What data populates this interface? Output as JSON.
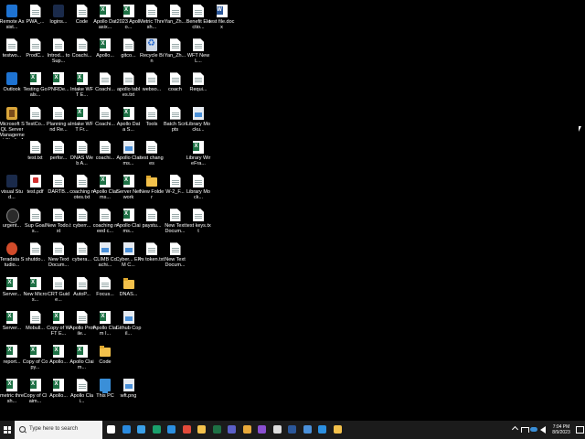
{
  "desktop": {
    "icons": [
      {
        "name": "remote-assistance-icon",
        "label": "Remote Assist...",
        "kind": "app-blue"
      },
      {
        "name": "pwa-icon",
        "label": "PWA_...",
        "kind": "doc"
      },
      {
        "name": "logins-icon",
        "label": "logins...",
        "kind": "app-navy"
      },
      {
        "name": "code-icon",
        "label": "Code",
        "kind": "doc"
      },
      {
        "name": "apollo-datasix-icon",
        "label": "Apollo Datasix...",
        "kind": "excel"
      },
      {
        "name": "apollo-2023-icon",
        "label": "2023 Apollo...",
        "kind": "excel"
      },
      {
        "name": "metric-thresh-icon",
        "label": "Metric Thresh...",
        "kind": "doc"
      },
      {
        "name": "yan-zh-icon",
        "label": "Yan_Zh...",
        "kind": "doc"
      },
      {
        "name": "benefit-electio-icon",
        "label": "Benefit Electio...",
        "kind": "doc"
      },
      {
        "name": "test-file-icon",
        "label": "test file.docx",
        "kind": "word"
      },
      {
        "name": "testwo-icon",
        "label": "testwo...",
        "kind": "doc"
      },
      {
        "name": "prodc-icon",
        "label": "ProdC...",
        "kind": "doc"
      },
      {
        "name": "introd-icon",
        "label": "Introd... to Sup...",
        "kind": "doc"
      },
      {
        "name": "coachi-1-icon",
        "label": "Coachi...",
        "kind": "doc"
      },
      {
        "name": "apollo-1-icon",
        "label": "Apollo...",
        "kind": "excel"
      },
      {
        "name": "gitco-icon",
        "label": "gitco...",
        "kind": "doc"
      },
      {
        "name": "recycle-bin-icon",
        "label": "Recycle Bin",
        "kind": "recycle"
      },
      {
        "name": "yan-zh-2-icon",
        "label": "Yan_Zh...",
        "kind": "doc"
      },
      {
        "name": "wft-new-icon",
        "label": "WFT New L...",
        "kind": "doc"
      },
      {
        "name": "outlook-icon",
        "label": "Outlook",
        "kind": "app-blue"
      },
      {
        "name": "testing-goals-icon",
        "label": "Testing Goals...",
        "kind": "excel"
      },
      {
        "name": "pnrde-icon",
        "label": "PNRDe...",
        "kind": "excel"
      },
      {
        "name": "intake-wft-icon",
        "label": "Intake WFT E...",
        "kind": "excel"
      },
      {
        "name": "coachi-2-icon",
        "label": "Coachi...",
        "kind": "doc"
      },
      {
        "name": "apollo-tables-icon",
        "label": "apollo tables.txt",
        "kind": "doc"
      },
      {
        "name": "webso-icon",
        "label": "webso...",
        "kind": "doc"
      },
      {
        "name": "coach-icon",
        "label": "coach",
        "kind": "doc"
      },
      {
        "name": "requi-icon",
        "label": "Requi...",
        "kind": "doc"
      },
      {
        "name": "ssms-icon",
        "label": "Microsoft SQL Server Management Studio 18",
        "kind": "ssms"
      },
      {
        "name": "testco-icon",
        "label": "TestCo...",
        "kind": "doc"
      },
      {
        "name": "planning-icon",
        "label": "Planning and Re...",
        "kind": "doc"
      },
      {
        "name": "intake-wft-fr-icon",
        "label": "Intake WFT Fr...",
        "kind": "excel"
      },
      {
        "name": "coachi-3-icon",
        "label": "Coachi...",
        "kind": "doc"
      },
      {
        "name": "apollo-data-icon",
        "label": "Apollo Data S...",
        "kind": "excel"
      },
      {
        "name": "tools-icon",
        "label": "Tools",
        "kind": "doc"
      },
      {
        "name": "batch-scripts-icon",
        "label": "Batch Scripts",
        "kind": "doc"
      },
      {
        "name": "library-mocku-icon",
        "label": "Library Mocku...",
        "kind": "image"
      },
      {
        "name": "test-txt-icon",
        "label": "test.txt",
        "kind": "doc"
      },
      {
        "name": "perfor-icon",
        "label": "perfor...",
        "kind": "doc"
      },
      {
        "name": "dnas-web-icon",
        "label": "DNAS Web A...",
        "kind": "doc"
      },
      {
        "name": "coachi-4-icon",
        "label": "coachi...",
        "kind": "doc"
      },
      {
        "name": "apollo-claims-icon",
        "label": "Apollo Claims...",
        "kind": "image"
      },
      {
        "name": "test-changes-icon",
        "label": "test changes",
        "kind": "doc"
      },
      {
        "name": "library-wirefra-icon",
        "label": "Library WireFra...",
        "kind": "excel"
      },
      {
        "name": "visual-studio-icon",
        "label": "visual Stud...",
        "kind": "app-navy"
      },
      {
        "name": "test-pdf-icon",
        "label": "test.pdf",
        "kind": "pdf"
      },
      {
        "name": "dartb-icon",
        "label": "DARTB...",
        "kind": "doc"
      },
      {
        "name": "coaching-notes-icon",
        "label": "coaching notes.txt",
        "kind": "doc"
      },
      {
        "name": "apollo-claims-2-icon",
        "label": "Apollo Claims...",
        "kind": "excel"
      },
      {
        "name": "server-network-icon",
        "label": "Server Network",
        "kind": "excel"
      },
      {
        "name": "new-folder-icon",
        "label": "New Folder",
        "kind": "folder"
      },
      {
        "name": "w2-f-icon",
        "label": "W-2_F...",
        "kind": "doc"
      },
      {
        "name": "library-mock-icon",
        "label": "Library Mock...",
        "kind": "doc"
      },
      {
        "name": "urgent-icon",
        "label": "urgent...",
        "kind": "setting"
      },
      {
        "name": "sup-goals-icon",
        "label": "Sup Goals...",
        "kind": "doc"
      },
      {
        "name": "new-todo-icon",
        "label": "New Todo.txt",
        "kind": "doc"
      },
      {
        "name": "cyberr-icon",
        "label": "cyberr...",
        "kind": "doc"
      },
      {
        "name": "coaching-need-icon",
        "label": "coaching need c...",
        "kind": "doc"
      },
      {
        "name": "apollo-claims-3-icon",
        "label": "Apollo Claims...",
        "kind": "excel"
      },
      {
        "name": "paystu-icon",
        "label": "paystu...",
        "kind": "doc"
      },
      {
        "name": "new-text-docum-icon",
        "label": "New Text Docum...",
        "kind": "doc"
      },
      {
        "name": "test-keys-icon",
        "label": "test keys.txt",
        "kind": "doc"
      },
      {
        "name": "teradata-studio-icon",
        "label": "Teradata Studio...",
        "kind": "app-red"
      },
      {
        "name": "shutdo-icon",
        "label": "shutdo...",
        "kind": "doc"
      },
      {
        "name": "new-text-docum-2-icon",
        "label": "New Text Docum...",
        "kind": "doc"
      },
      {
        "name": "cybera-icon",
        "label": "cybera...",
        "kind": "doc"
      },
      {
        "name": "climb-coachi-icon",
        "label": "CLIMB Coachi...",
        "kind": "image"
      },
      {
        "name": "cyber-epm-icon",
        "label": "Cyber... EPM C...",
        "kind": "image"
      },
      {
        "name": "vs-token-icon",
        "label": "vs token.txt",
        "kind": "doc"
      },
      {
        "name": "new-text-docum-3-icon",
        "label": "New Text Docum...",
        "kind": "doc"
      },
      {
        "name": "server-icon",
        "label": "Server...",
        "kind": "excel"
      },
      {
        "name": "new-micros-icon",
        "label": "New Micros...",
        "kind": "excel"
      },
      {
        "name": "crt-guide-icon",
        "label": "CRT Guide...",
        "kind": "doc"
      },
      {
        "name": "autop-icon",
        "label": "AutoP...",
        "kind": "doc"
      },
      {
        "name": "focus-icon",
        "label": "Focus...",
        "kind": "doc"
      },
      {
        "name": "dnas-icon",
        "label": "DNAS...",
        "kind": "folder"
      },
      {
        "name": "server-2-icon",
        "label": "Server...",
        "kind": "excel"
      },
      {
        "name": "mobull-icon",
        "label": "Mobull...",
        "kind": "doc"
      },
      {
        "name": "copy-of-wft-icon",
        "label": "Copy of WFT E...",
        "kind": "excel"
      },
      {
        "name": "apollo-profile-icon",
        "label": "Apollo Profile...",
        "kind": "doc"
      },
      {
        "name": "apollo-claim-icon",
        "label": "Apollo Claim I...",
        "kind": "excel"
      },
      {
        "name": "github-copil-icon",
        "label": "Github Copil...",
        "kind": "image"
      },
      {
        "name": "report-icon",
        "label": "report...",
        "kind": "excel"
      },
      {
        "name": "copy-of-copy-icon",
        "label": "Copy of Copy...",
        "kind": "excel"
      },
      {
        "name": "apollo-2-icon",
        "label": "Apollo...",
        "kind": "excel"
      },
      {
        "name": "apollo-claim-2-icon",
        "label": "Apollo Claim...",
        "kind": "excel"
      },
      {
        "name": "code-2-icon",
        "label": "Code",
        "kind": "folder"
      },
      {
        "name": "metric-thresh-2-icon",
        "label": "metric thresh...",
        "kind": "excel"
      },
      {
        "name": "copy-of-claim-icon",
        "label": "Copy of Claim...",
        "kind": "excel"
      },
      {
        "name": "apollo-3-icon",
        "label": "Apollo...",
        "kind": "excel"
      },
      {
        "name": "apollo-clai-icon",
        "label": "Apollo Clai...",
        "kind": "doc"
      },
      {
        "name": "this-pc-icon",
        "label": "This PC",
        "kind": "pc"
      },
      {
        "name": "wft-png-icon",
        "label": "wft.png",
        "kind": "image"
      }
    ]
  },
  "taskbar": {
    "search_placeholder": "Type here to search",
    "pinned": [
      {
        "name": "task-view-icon",
        "color": "#ffffff"
      },
      {
        "name": "edge-icon",
        "color": "#2a8be0"
      },
      {
        "name": "file-explorer-icon",
        "color": "#3aa0e8"
      },
      {
        "name": "edge-2-icon",
        "color": "#1aa06c"
      },
      {
        "name": "vscode-icon",
        "color": "#2b8fe0"
      },
      {
        "name": "chrome-icon",
        "color": "#e24a3a"
      },
      {
        "name": "folder-icon",
        "color": "#f3c14b"
      },
      {
        "name": "excel-icon",
        "color": "#1e7145"
      },
      {
        "name": "teams-icon",
        "color": "#5b5fc7"
      },
      {
        "name": "powerbi-icon",
        "color": "#e8a93a"
      },
      {
        "name": "visual-studio-taskbar-icon",
        "color": "#8a4fd0"
      },
      {
        "name": "app-icon",
        "color": "#ddd"
      },
      {
        "name": "word-icon",
        "color": "#2b579a"
      },
      {
        "name": "onenote-icon",
        "color": "#4a90d9"
      },
      {
        "name": "vscode-2-icon",
        "color": "#2b8fe0"
      },
      {
        "name": "snip-icon",
        "color": "#f3c14b"
      }
    ],
    "clock_time": "7:04 PM",
    "clock_date": "8/9/2023"
  }
}
